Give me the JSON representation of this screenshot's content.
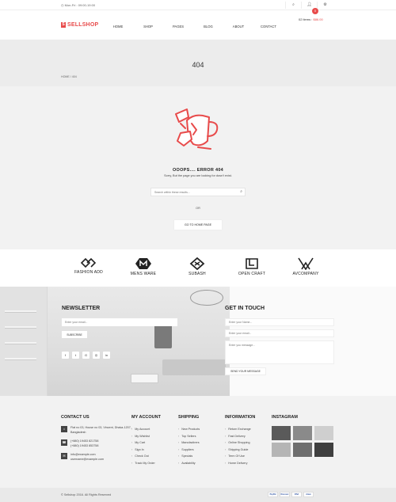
{
  "topbar": {
    "hours": "Mon-Fri : 09:00-19:00",
    "icons": [
      "search-icon",
      "user-icon",
      "gear-icon"
    ]
  },
  "header": {
    "logo": "SELLSHOP",
    "nav": [
      "HOME",
      "SHOP",
      "PAGES",
      "BLOG",
      "ABOUT",
      "CONTACT"
    ],
    "cart": {
      "count": "0",
      "items_label": "02 items :",
      "amount": "$86.00"
    }
  },
  "banner": {
    "title": "404",
    "breadcrumb": [
      "HOME",
      "404"
    ]
  },
  "error": {
    "title": "OOOPS.... ERROR 404",
    "subtitle": "Sorry, But the page you are looking for dosn't exist.",
    "search_placeholder": "Search within these results...",
    "or": "OR",
    "home_button": "GO TO HOME PAGE"
  },
  "brands": [
    "FASHION ADD",
    "MENS WARE",
    "SUBASH",
    "OPEN CRAFT",
    "AVCOMPANY"
  ],
  "newsletter": {
    "title": "NEWSLETTER",
    "email_placeholder": "Enter your email...",
    "subscribe": "SUBSCRIBE",
    "socials": [
      "facebook-icon",
      "twitter-icon",
      "google-plus-icon",
      "dribbble-icon",
      "linkedin-icon"
    ]
  },
  "get_in_touch": {
    "title": "GET IN TOUCH",
    "name_placeholder": "Enter your Name...",
    "email_placeholder": "Enter your email...",
    "message_placeholder": "Enter you message...",
    "send": "SEND YOUR MESSAGE"
  },
  "footer": {
    "contact": {
      "title": "CONTACT US",
      "address": "Flat no 03, House no 03, Vincent, Dhaka-1207, Bangladesh",
      "phones": "(+880) 19453 821758\n(+880) 19453 853758",
      "emails": "info@example.com\nusername@example.com"
    },
    "my_account": {
      "title": "MY ACCOUNT",
      "links": [
        "My Account",
        "My Wishlist",
        "My Cart",
        "Sign In",
        "Check Out",
        "Track My Order"
      ]
    },
    "shipping": {
      "title": "SHIPPING",
      "links": [
        "New Products",
        "Top Sellers",
        "Manufactirers",
        "Suppliers",
        "Specials",
        "Availability"
      ]
    },
    "information": {
      "title": "INFORMATION",
      "links": [
        "Return Exchange",
        "Fast Delivery",
        "Online Shopping",
        "Shipping Guide",
        "Term Of Use",
        "Home Delivery"
      ]
    },
    "instagram": {
      "title": "INSTAGRAM"
    },
    "copyright": "© Sellshop 2016. All Rights Reserved",
    "payments": [
      "PayPal",
      "Discover",
      "VISA",
      "Amex"
    ]
  },
  "colors": {
    "accent": "#e84b4b"
  }
}
